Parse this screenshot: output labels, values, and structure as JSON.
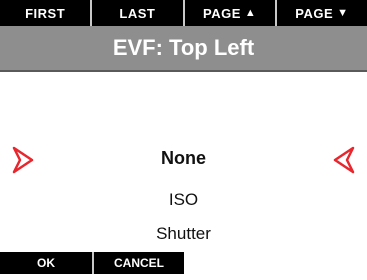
{
  "softkeys": {
    "first": "FIRST",
    "last": "LAST",
    "page_up": "PAGE",
    "page_down": "PAGE"
  },
  "title": "EVF: Top Left",
  "options": [
    "None",
    "ISO",
    "Shutter"
  ],
  "selected_option": "None",
  "buttons": {
    "ok": "OK",
    "cancel": "CANCEL"
  },
  "icons": {
    "left": "left-arrow-icon",
    "right": "right-arrow-icon"
  },
  "colors": {
    "arrow": "#e8262d",
    "title_bar": "#8e8e8e",
    "softkey_bg": "#000000"
  }
}
